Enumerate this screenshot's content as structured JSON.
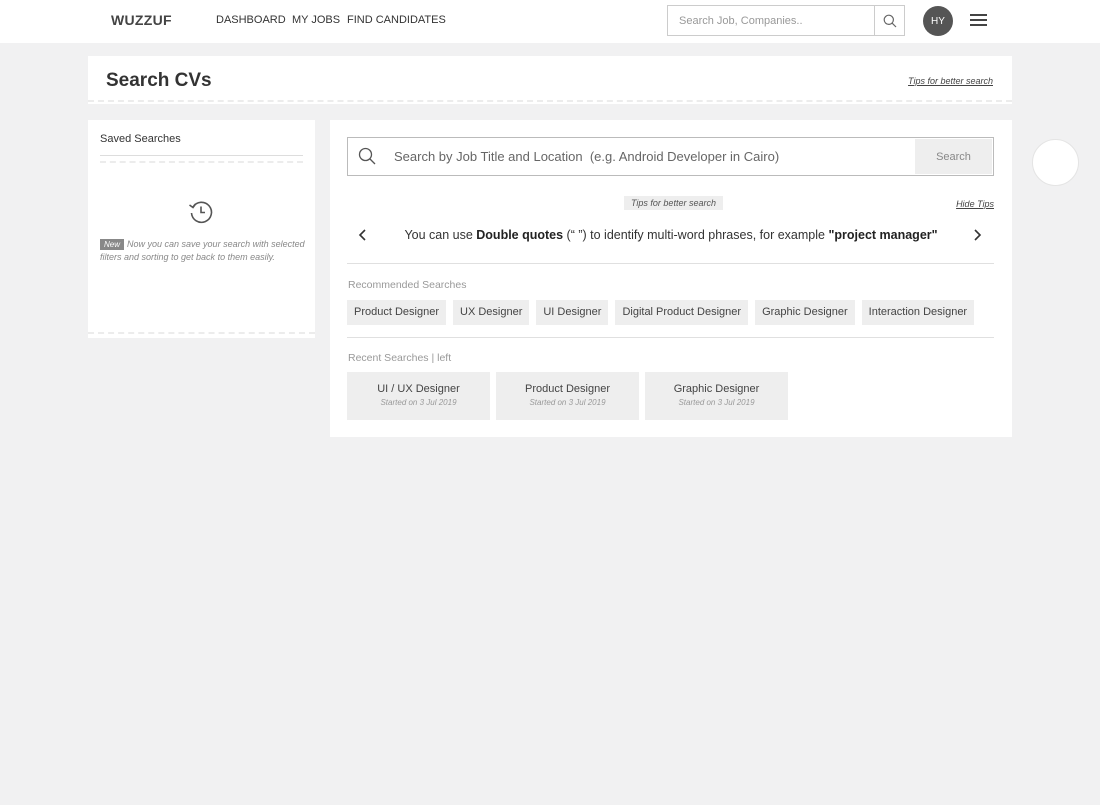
{
  "nav": {
    "logo": "WUZZUF",
    "links": [
      "DASHBOARD",
      "MY JOBS",
      "FIND CANDIDATES"
    ],
    "search_placeholder": "Search Job, Companies..",
    "avatar_initials": "HY"
  },
  "page": {
    "title": "Search CVs",
    "tips_link": "Tips for better search"
  },
  "saved": {
    "title": "Saved Searches",
    "badge": "New",
    "note": "Now you can save your search with selected filters and sorting to get back to them easily."
  },
  "search": {
    "placeholder": "Search by Job Title and Location  (e.g. Android Developer in Cairo)",
    "button": "Search"
  },
  "tips": {
    "label": "Tips for better search",
    "hide": "Hide Tips",
    "text_before": "You can use ",
    "text_bold1": "Double quotes",
    "text_mid": "  (“ ”) to identify multi-word phrases, for example ",
    "text_bold2": "\"project manager\""
  },
  "recommended": {
    "label": "Recommended Searches",
    "items": [
      "Product Designer",
      "UX Designer",
      "UI Designer",
      "Digital Product Designer",
      "Graphic Designer",
      "Interaction Designer"
    ]
  },
  "recent": {
    "label": "Recent Searches | left",
    "items": [
      {
        "title": "UI / UX Designer",
        "date": "Started on 3 Jul 2019"
      },
      {
        "title": "Product Designer",
        "date": "Started on 3 Jul 2019"
      },
      {
        "title": "Graphic Designer",
        "date": "Started on 3 Jul 2019"
      }
    ]
  }
}
